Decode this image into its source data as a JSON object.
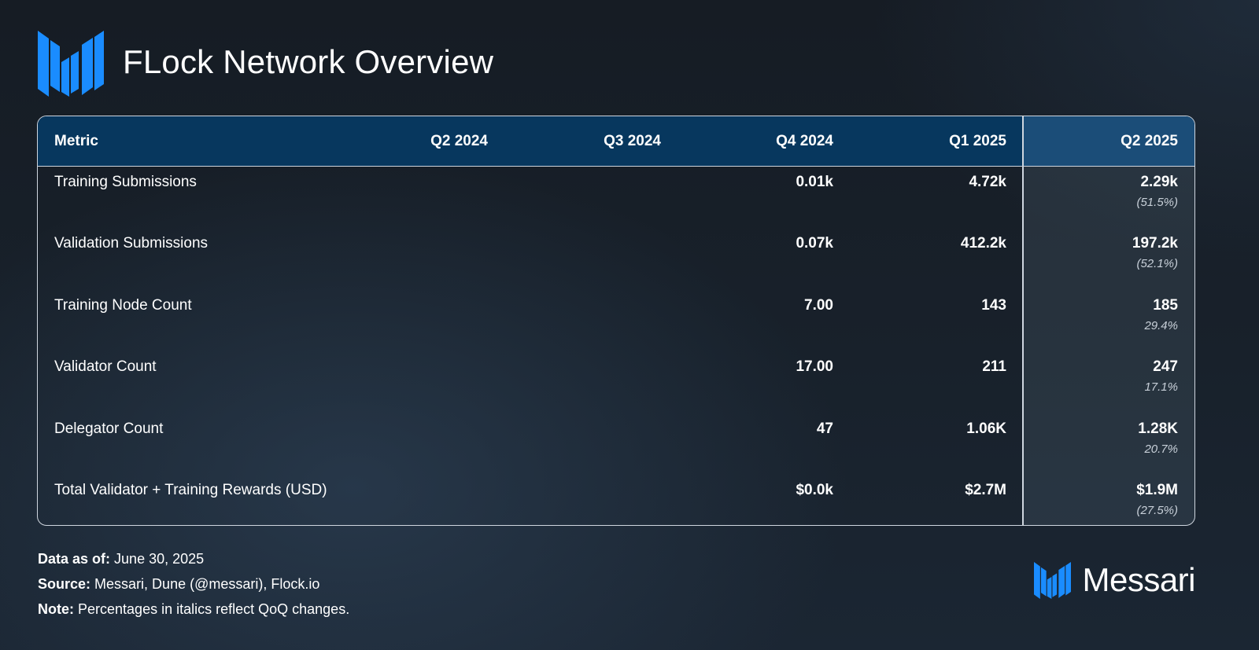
{
  "title": "FLock Network Overview",
  "colors": {
    "header_bg": "#07375e",
    "header_q2_bg": "#1b4d78",
    "logo_blue": "#1a8cff",
    "border": "#cfd6df"
  },
  "icons": {
    "logo": "messari-logo-icon",
    "brand": "messari-logo-icon"
  },
  "chart_data": {
    "type": "table",
    "title": "FLock Network Overview",
    "columns": [
      "Metric",
      "Q2 2024",
      "Q3 2024",
      "Q4 2024",
      "Q1 2025",
      "Q2 2025"
    ],
    "rows": [
      {
        "metric": "Training Submissions",
        "q2_2024": "",
        "q3_2024": "",
        "q4_2024": "0.01k",
        "q1_2025": "4.72k",
        "q2_2025": "2.29k",
        "q2_2025_change": "(51.5%)"
      },
      {
        "metric": "Validation Submissions",
        "q2_2024": "",
        "q3_2024": "",
        "q4_2024": "0.07k",
        "q1_2025": "412.2k",
        "q2_2025": "197.2k",
        "q2_2025_change": "(52.1%)"
      },
      {
        "metric": "Training Node Count",
        "q2_2024": "",
        "q3_2024": "",
        "q4_2024": "7.00",
        "q1_2025": "143",
        "q2_2025": "185",
        "q2_2025_change": "29.4%"
      },
      {
        "metric": "Validator Count",
        "q2_2024": "",
        "q3_2024": "",
        "q4_2024": "17.00",
        "q1_2025": "211",
        "q2_2025": "247",
        "q2_2025_change": "17.1%"
      },
      {
        "metric": "Delegator Count",
        "q2_2024": "",
        "q3_2024": "",
        "q4_2024": "47",
        "q1_2025": "1.06K",
        "q2_2025": "1.28K",
        "q2_2025_change": "20.7%"
      },
      {
        "metric": "Total Validator + Training Rewards (USD)",
        "q2_2024": "",
        "q3_2024": "",
        "q4_2024": "$0.0k",
        "q1_2025": "$2.7M",
        "q2_2025": "$1.9M",
        "q2_2025_change": "(27.5%)"
      }
    ]
  },
  "footer": {
    "data_as_of_label": "Data as of:",
    "data_as_of_value": "June 30, 2025",
    "source_label": "Source:",
    "source_value": "Messari, Dune (@messari), Flock.io",
    "note_label": "Note:",
    "note_value": "Percentages in italics reflect QoQ changes."
  },
  "brand": {
    "name": "Messari"
  }
}
